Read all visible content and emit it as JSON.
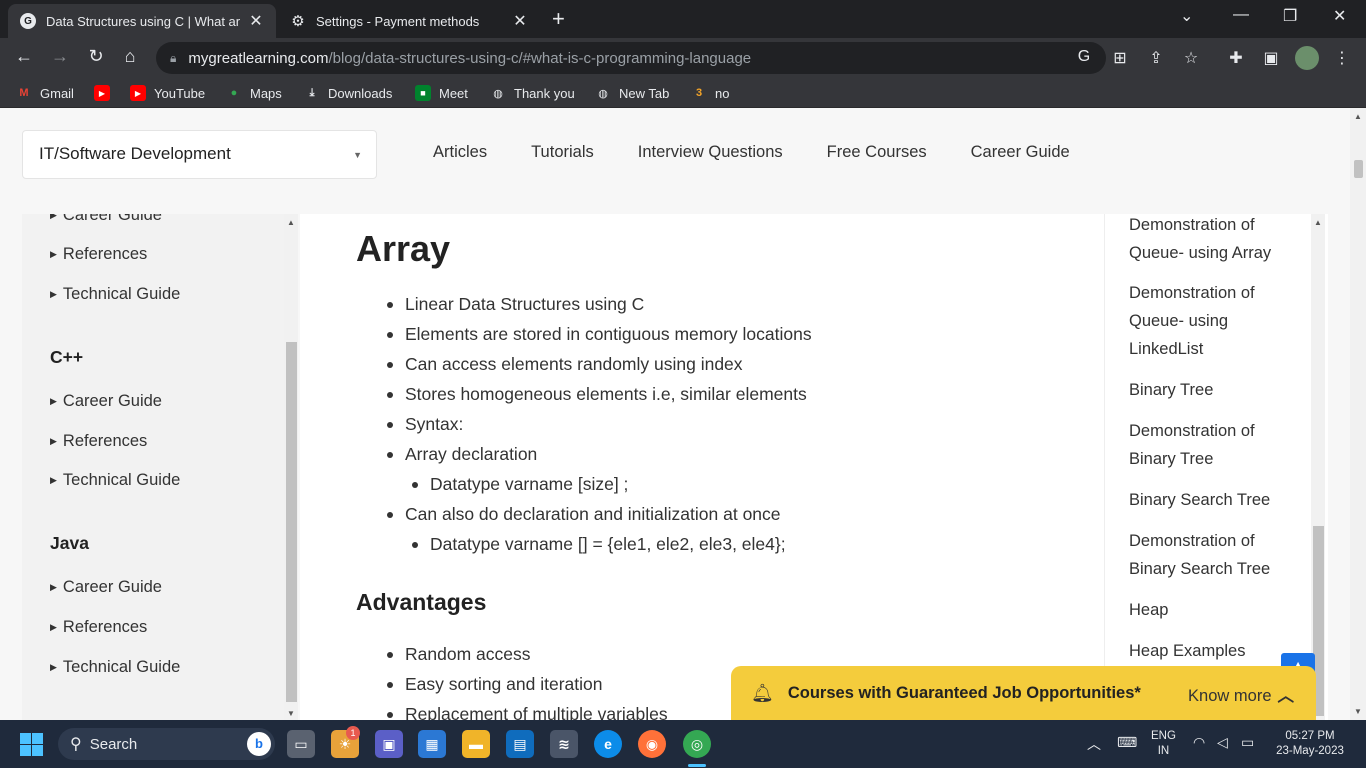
{
  "browser": {
    "tabs": [
      {
        "title": "Data Structures using C | What ar",
        "icon": "great-learning-icon"
      },
      {
        "title": "Settings - Payment methods",
        "icon": "gear-icon"
      }
    ],
    "url_domain": "mygreatlearning.com",
    "url_path": "/blog/data-structures-using-c/#what-is-c-programming-language",
    "bookmarks": [
      "Gmail",
      "",
      "YouTube",
      "Maps",
      "Downloads",
      "Meet",
      "Thank you",
      "New Tab",
      "no"
    ]
  },
  "site": {
    "category_select": "IT/Software Development",
    "nav": [
      "Articles",
      "Tutorials",
      "Interview Questions",
      "Free Courses",
      "Career Guide"
    ]
  },
  "left_sidebar": {
    "partial_top": "Career Guide",
    "top_items": [
      "References",
      "Technical Guide"
    ],
    "sections": [
      {
        "title": "C++",
        "items": [
          "Career Guide",
          "References",
          "Technical Guide"
        ]
      },
      {
        "title": "Java",
        "items": [
          "Career Guide",
          "References",
          "Technical Guide"
        ]
      }
    ]
  },
  "article": {
    "heading": "Array",
    "bullets": [
      "Linear Data Structures using C",
      "Elements are stored in contiguous memory locations",
      "Can access elements randomly using index",
      "Stores homogeneous elements i.e, similar elements",
      "Syntax:",
      "Array declaration",
      "Datatype varname [size]  ;",
      "Can also do declaration and initialization at once",
      "Datatype varname [] = {ele1, ele2, ele3, ele4};"
    ],
    "subheading": "Advantages",
    "advantages": [
      "Random access",
      "Easy sorting and iteration",
      "Replacement of multiple variables"
    ]
  },
  "right_sidebar": {
    "items": [
      "Demonstration of Queue- using Array",
      "Demonstration of Queue- using LinkedList",
      "Binary Tree",
      "Demonstration of Binary Tree",
      "Binary Search Tree",
      "Demonstration of Binary Search Tree",
      "Heap",
      "Heap Examples"
    ]
  },
  "promo": {
    "text": "Courses with Guaranteed Job Opportunities*",
    "action": "Know more"
  },
  "taskbar": {
    "search_label": "Search",
    "notification_count": "1",
    "lang_line1": "ENG",
    "lang_line2": "IN",
    "time": "05:27 PM",
    "date": "23-May-2023"
  },
  "colors": {
    "accent": "#1a73e8",
    "promo_bg": "#f4cc3c",
    "chrome_dark": "#202124"
  }
}
